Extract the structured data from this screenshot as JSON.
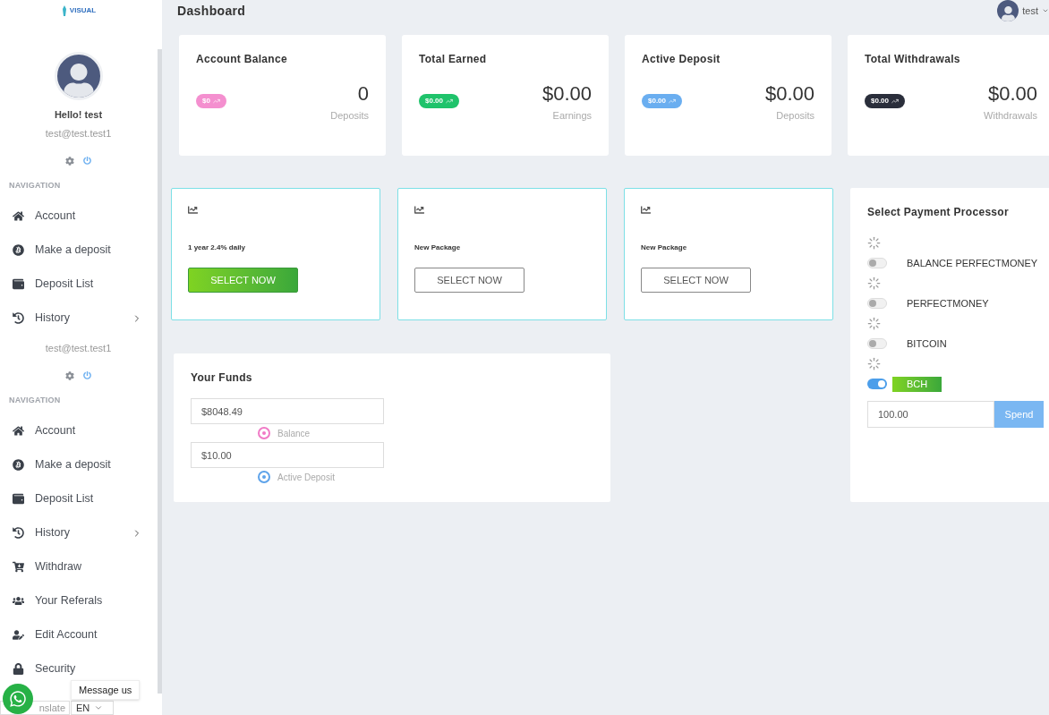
{
  "sidebar": {
    "logo": "VISUAL",
    "profile_top": {
      "greeting": "Hello! test",
      "email": "test@test.test1"
    },
    "nav_1": {
      "heading": "NAVIGATION",
      "items": [
        {
          "label": "Account",
          "expandable": false
        },
        {
          "label": "Make a deposit",
          "expandable": false
        },
        {
          "label": "Deposit List",
          "expandable": false
        },
        {
          "label": "History",
          "expandable": true
        }
      ]
    },
    "profile_bottom": {
      "email": "test@test.test1"
    },
    "nav_2": {
      "heading": "NAVIGATION",
      "items": [
        {
          "label": "Account",
          "expandable": false
        },
        {
          "label": "Make a deposit",
          "expandable": false
        },
        {
          "label": "Deposit List",
          "expandable": false
        },
        {
          "label": "History",
          "expandable": true
        },
        {
          "label": "Withdraw",
          "expandable": false
        },
        {
          "label": "Your Referals",
          "expandable": false
        },
        {
          "label": "Edit Account",
          "expandable": false
        },
        {
          "label": "Security",
          "expandable": false
        }
      ]
    }
  },
  "header": {
    "title": "Dashboard",
    "user": "test"
  },
  "stats": [
    {
      "title": "Account Balance",
      "badge": "$0",
      "color": "#f48fcf",
      "value": "0",
      "caption": "Deposits"
    },
    {
      "title": "Total Earned",
      "badge": "$0.00",
      "color": "#1fc36b",
      "value": "$0.00",
      "caption": "Earnings"
    },
    {
      "title": "Active Deposit",
      "badge": "$0.00",
      "color": "#6aaef0",
      "value": "$0.00",
      "caption": "Deposits"
    },
    {
      "title": "Total Withdrawals",
      "badge": "$0.00",
      "color": "#2a2e3b",
      "value": "$0.00",
      "caption": "Withdrawals"
    }
  ],
  "packages": [
    {
      "name": "1 year 2.4% daily",
      "button": "SELECT NOW",
      "selected": true
    },
    {
      "name": "New Package",
      "button": "SELECT NOW",
      "selected": false
    },
    {
      "name": "New Package",
      "button": "SELECT NOW",
      "selected": false
    }
  ],
  "payment": {
    "title": "Select Payment Processor",
    "processors": [
      {
        "label": "BALANCE PERFECTMONEY",
        "on": false
      },
      {
        "label": "PERFECTMONEY",
        "on": false
      },
      {
        "label": "BITCOIN",
        "on": false
      },
      {
        "label": "BCH",
        "on": true
      }
    ],
    "amount": "100.00",
    "button": "Spend"
  },
  "funds": {
    "title": "Your Funds",
    "entries": [
      {
        "value": "$8048.49",
        "legend": "Balance",
        "color": "#f07ac6"
      },
      {
        "value": "$10.00",
        "legend": "Active Deposit",
        "color": "#5ea3ea"
      }
    ]
  },
  "chat": {
    "label": "Message us"
  },
  "translate": {
    "label": "nslate",
    "language": "EN"
  }
}
